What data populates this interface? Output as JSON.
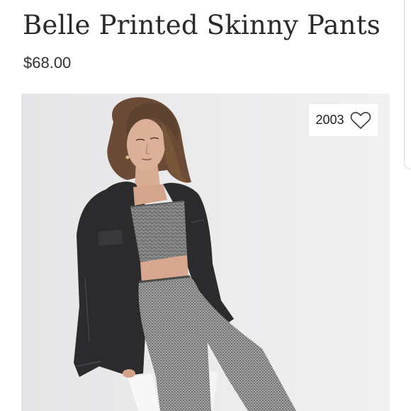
{
  "product": {
    "title": "Belle Printed Skinny Pants",
    "price": "$68.00"
  },
  "like": {
    "count": "2003",
    "icon": "heart-outline-icon"
  },
  "image": {
    "subject": "product-photo",
    "background_color": "#ececed"
  },
  "colors": {
    "title_text": "#2a2a2a",
    "price_text": "#333333",
    "jacket": "#2b2b2d",
    "pants": "#8f8f8f"
  }
}
